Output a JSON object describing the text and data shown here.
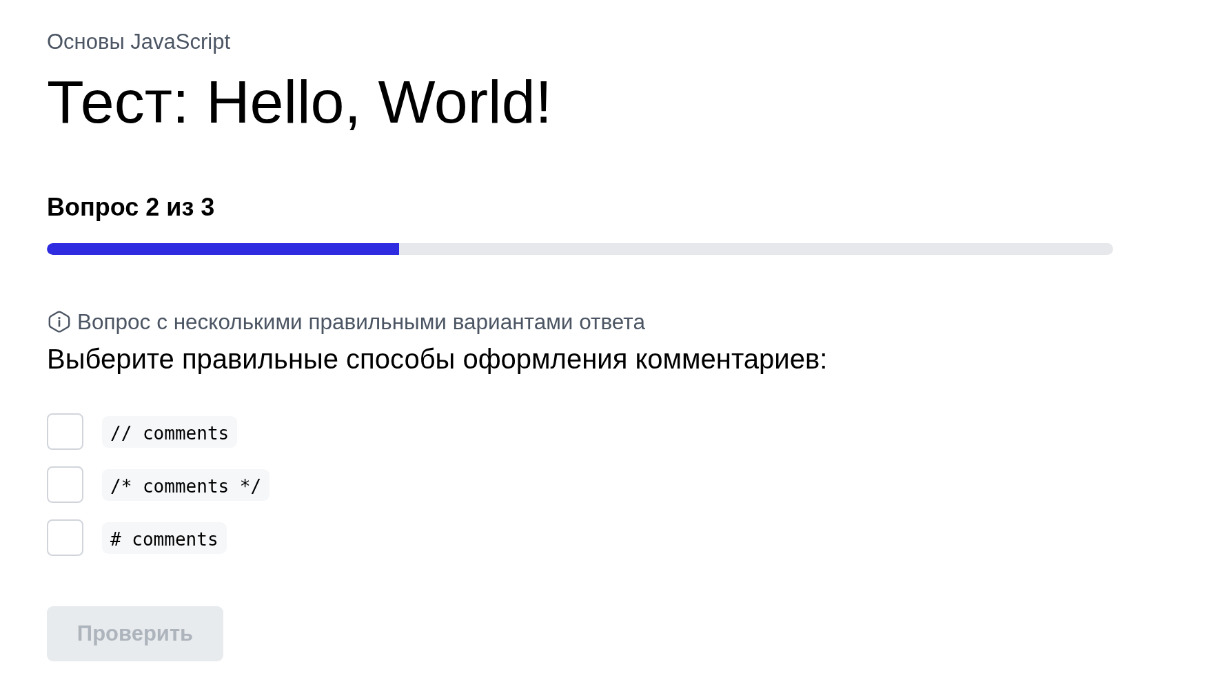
{
  "breadcrumb": "Основы JavaScript",
  "title": "Тест: Hello, World!",
  "progress": {
    "label": "Вопрос 2 из 3",
    "level": 0.33
  },
  "question": {
    "hint": "Вопрос с несколькими правильными вариантами ответа",
    "text": "Выберите правильные способы оформления комментариев:",
    "options": [
      {
        "code": "// comments",
        "checked": false
      },
      {
        "code": "/* comments */",
        "checked": false
      },
      {
        "code": "# comments",
        "checked": false
      }
    ]
  },
  "submit_button": {
    "label": "Проверить",
    "disabled": true
  }
}
